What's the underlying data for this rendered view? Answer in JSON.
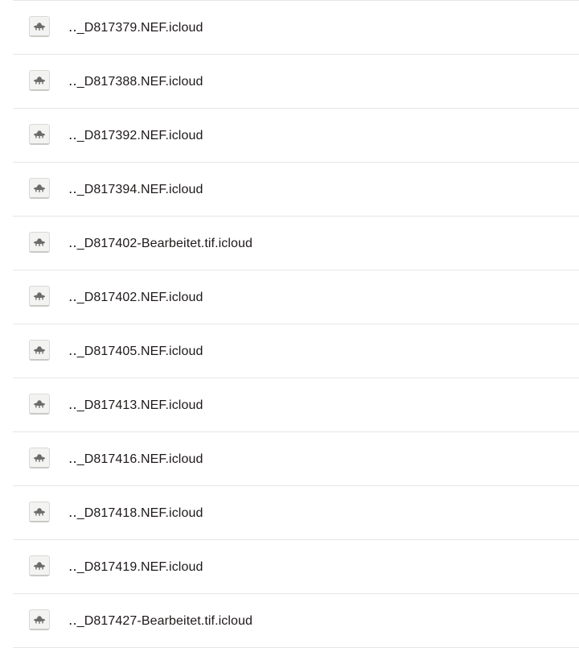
{
  "files": {
    "icon": "ufo-icon",
    "icon_color": "#6b6b6b",
    "items": [
      {
        "name": "‥_D817379.NEF.icloud"
      },
      {
        "name": "‥_D817388.NEF.icloud"
      },
      {
        "name": "‥_D817392.NEF.icloud"
      },
      {
        "name": "‥_D817394.NEF.icloud"
      },
      {
        "name": "‥_D817402-Bearbeitet.tif.icloud"
      },
      {
        "name": "‥_D817402.NEF.icloud"
      },
      {
        "name": "‥_D817405.NEF.icloud"
      },
      {
        "name": "‥_D817413.NEF.icloud"
      },
      {
        "name": "‥_D817416.NEF.icloud"
      },
      {
        "name": "‥_D817418.NEF.icloud"
      },
      {
        "name": "‥_D817419.NEF.icloud"
      },
      {
        "name": "‥_D817427-Bearbeitet.tif.icloud"
      }
    ]
  }
}
